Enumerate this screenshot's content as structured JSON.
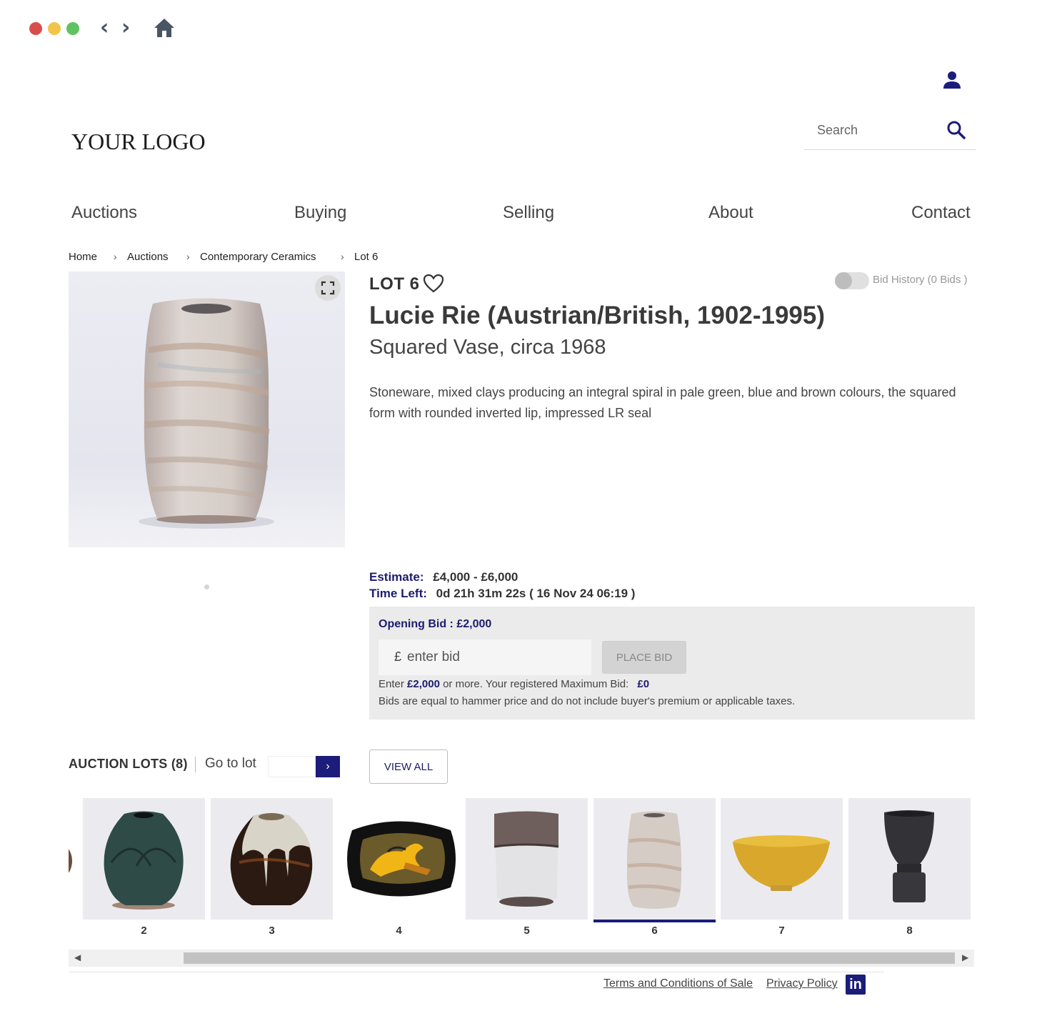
{
  "chrome": {
    "dot_colors": [
      "#d94d4d",
      "#f2c54a",
      "#5fc35f"
    ],
    "back_glyph": "‹",
    "forward_glyph": "›"
  },
  "header": {
    "logo": "YOUR LOGO",
    "search_placeholder": "Search"
  },
  "nav": [
    "Auctions",
    "Buying",
    "Selling",
    "About",
    "Contact"
  ],
  "breadcrumb": [
    "Home",
    "Auctions",
    "Contemporary Ceramics",
    "Lot 6"
  ],
  "breadcrumb_sep": "›",
  "lot": {
    "title": "LOT 6",
    "artist": "Lucie Rie (Austrian/British, 1902-1995)",
    "subtitle": "Squared Vase, circa 1968",
    "description": "Stoneware, mixed clays producing an integral spiral in pale green, blue and brown colours, the squared form with rounded inverted lip, impressed LR seal",
    "bid_history": "Bid History (0 Bids )",
    "estimate_label": "Estimate:",
    "estimate_value": "£4,000 - £6,000",
    "time_left_label": "Time Left:",
    "time_left_value": "0d 21h 31m 22s ( 16 Nov 24 06:19 )"
  },
  "bid_panel": {
    "opening_bid": "Opening Bid : £2,000",
    "currency": "£",
    "input_placeholder": "enter bid",
    "place_bid_label": "PLACE BID",
    "note_prefix": "Enter",
    "note_amount": "£2,000",
    "note_middle": "or more. Your registered Maximum Bid:",
    "note_max": "£0",
    "note_2": "Bids are equal to hammer price and do not include buyer's premium or applicable taxes."
  },
  "lots": {
    "heading": "AUCTION LOTS (8)",
    "goto_label": "Go to lot",
    "goto_button": "›",
    "view_all": "VIEW ALL",
    "thumbnails": [
      "2",
      "3",
      "4",
      "5",
      "6",
      "7",
      "8"
    ],
    "active": "6"
  },
  "footer": {
    "terms": "Terms and Conditions of Sale",
    "privacy": "Privacy Policy",
    "linkedin": "in"
  },
  "colors": {
    "accent_navy": "#1c1c7a"
  }
}
